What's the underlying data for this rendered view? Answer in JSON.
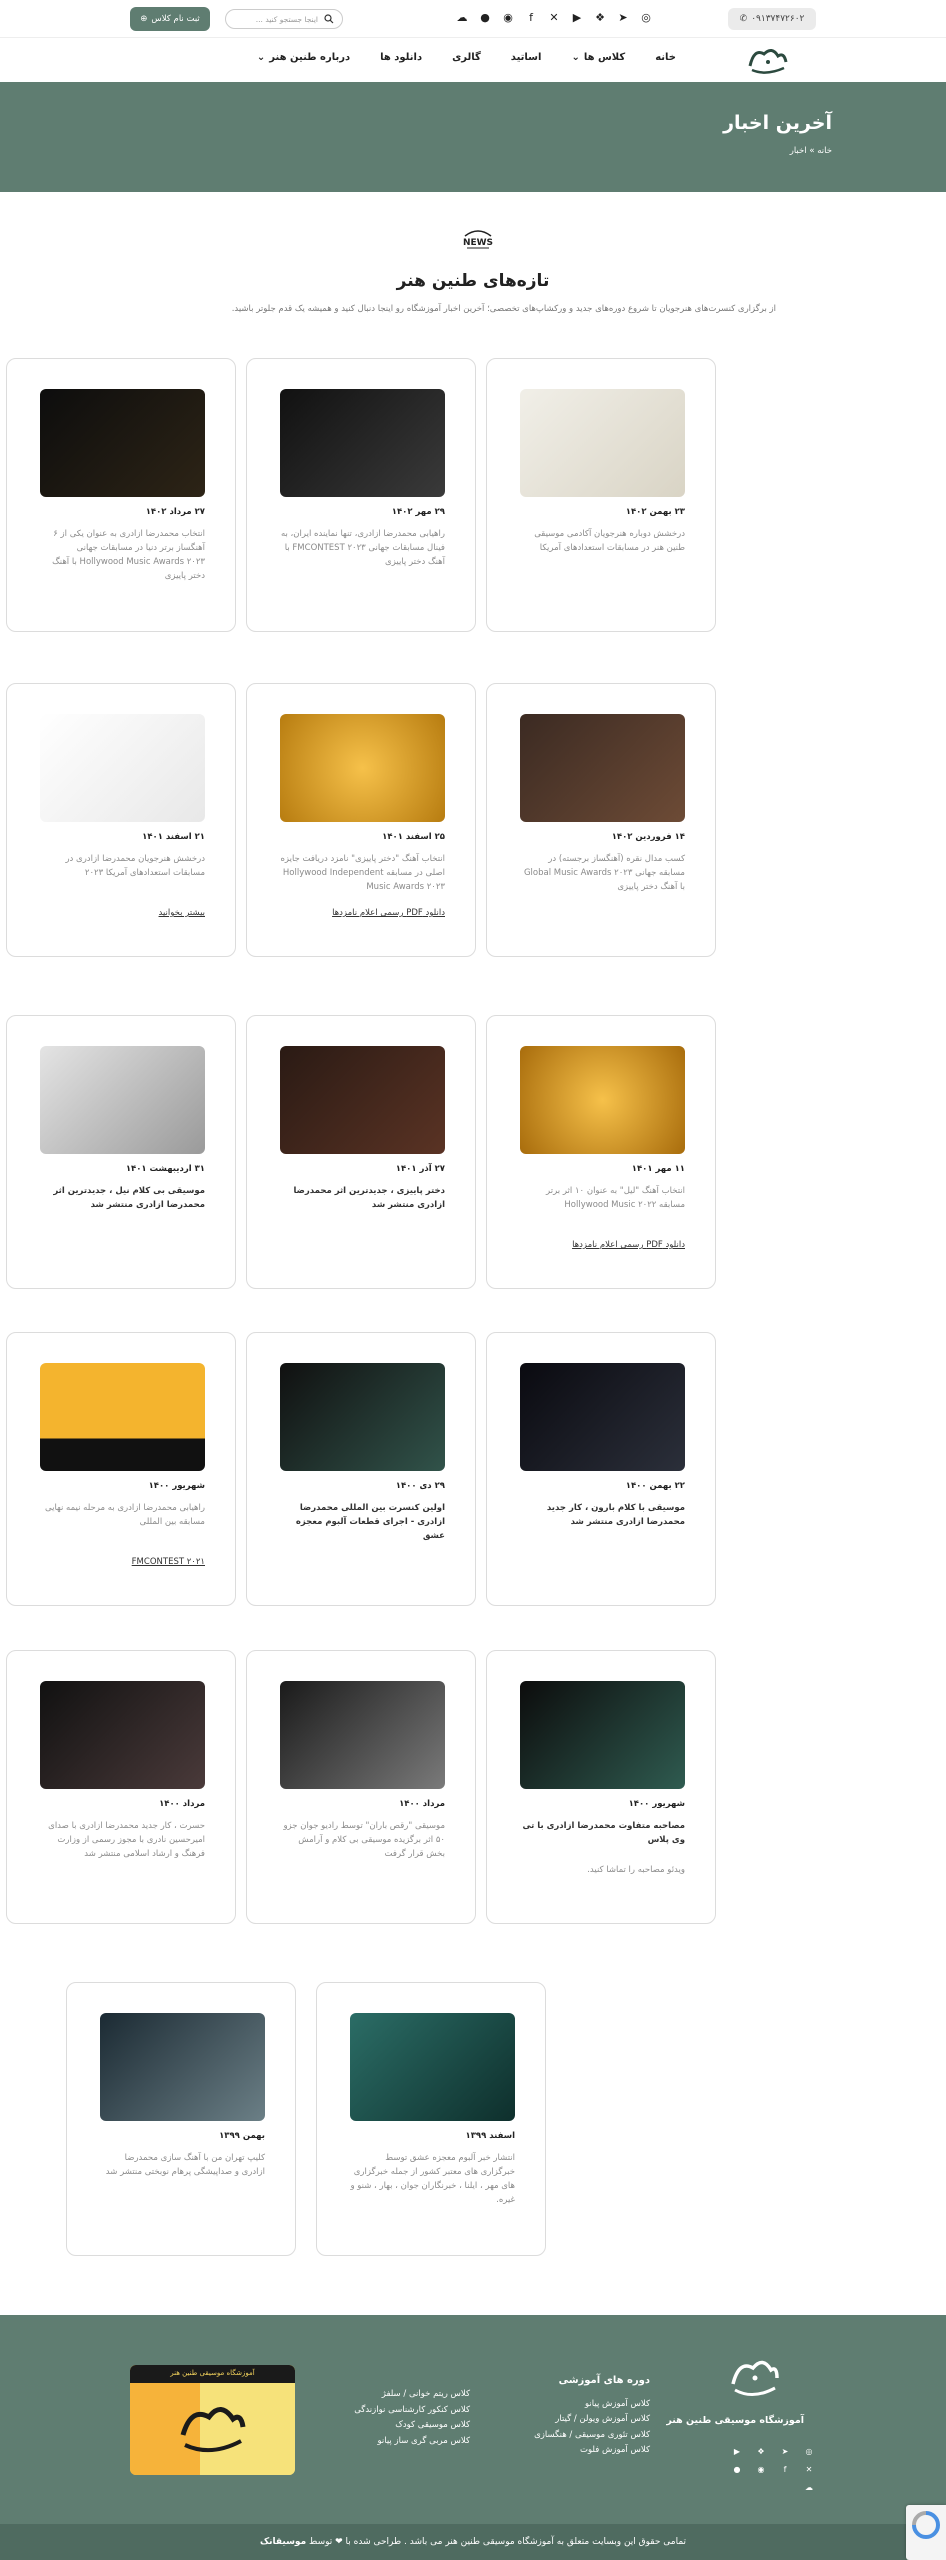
{
  "topbar": {
    "phone": "۰۹۱۳۷۴۷۲۶۰۲",
    "search_placeholder": "اینجا جستجو کنید ...",
    "register_label": "ثبت نام کلاس",
    "socials": [
      "instagram-icon",
      "telegram-icon",
      "aparat-icon",
      "youtube-icon",
      "x-icon",
      "facebook-icon",
      "spotify-icon",
      "apple-music-icon",
      "soundcloud-icon"
    ]
  },
  "nav": {
    "items": [
      {
        "label": "خانه"
      },
      {
        "label": "کلاس ها",
        "has_dropdown": true
      },
      {
        "label": "اساتید"
      },
      {
        "label": "گالری"
      },
      {
        "label": "دانلود ها"
      },
      {
        "label": "درباره طنین هنر",
        "has_dropdown": true
      }
    ]
  },
  "hero": {
    "title": "آخرین اخبار",
    "breadcrumb_home": "خانه",
    "breadcrumb_sep": "»",
    "breadcrumb_current": "اخبار"
  },
  "intro": {
    "badge": "NEWS",
    "title": "تازه‌های طنین هنر",
    "description": "از برگزاری کنسرت‌های هنرجویان تا شروع دوره‌های جدید و ورکشاپ‌های تخصصی؛ آخرین اخبار آموزشگاه رو اینجا دنبال کنید و همیشه یک قدم جلوتر باشید."
  },
  "cards": [
    {
      "date": "۲۳ بهمن ۱۴۰۲",
      "text": "درخشش دوباره هنرجویان آکادمی موسیقی طنین هنر در مسابقات استعدادهای آمریکا",
      "link": "",
      "image": "certificate"
    },
    {
      "date": "۲۹ مهر ۱۴۰۲",
      "text": "راهیابی محمدرضا ازادری، تنها نماینده ایران، به فینال مسابقات جهانی FMCONTEST ۲۰۲۳ با آهنگ دختر پاییزی",
      "link": "",
      "image": "fmcontest"
    },
    {
      "date": "۲۷ مرداد ۱۴۰۲",
      "text": "انتخاب محمدرضا ازادری به عنوان یکی از ۶ آهنگساز برتر دنیا در مسابقات جهانی Hollywood Music Awards ۲۰۲۳ با آهنگ دختر پاییزی",
      "link": "",
      "image": "hollywood"
    },
    {
      "date": "۱۴ فروردین ۱۴۰۲",
      "text": "کسب مدال نقره (آهنگساز برجسته) در مسابقه جهانی Global Music Awards ۲۰۲۳ با آهنگ دختر پاییزی",
      "link": "",
      "image": "silver-medal"
    },
    {
      "date": "۲۵ اسفند ۱۴۰۱",
      "text": "انتخاب آهنگ \"دختر پاییزی\" نامزد دریافت جایزه اصلی در مسابقه Hollywood Independent Music Awards ۲۰۲۳",
      "link": "دانلود PDF رسمی اعلام نامزدها",
      "image": "nomination"
    },
    {
      "date": "۲۱ اسفند ۱۴۰۱",
      "text": "درخشش هنرجویان محمدرضا ازادری در مسابقات استعدادهای آمریکا ۲۰۲۳",
      "link": "بیشتر بخوانید",
      "image": "students"
    },
    {
      "date": "۱۱ مهر ۱۴۰۱",
      "text": "انتخاب آهنگ \"لیل\" به عنوان ۱۰ اثر برتر مسابقه Hollywood Music ۲۰۲۲",
      "link": "دانلود PDF رسمی اعلام نامزدها",
      "image": "nomination2"
    },
    {
      "date": "۲۷ آذر ۱۴۰۱",
      "text": "دختر پاییزی ، جدیدترین اثر محمدرضا ازادری منتشر شد",
      "link": "",
      "dark": true,
      "image": "autumn"
    },
    {
      "date": "۳۱ اردیبهشت ۱۴۰۱",
      "text": "موسیقی بی کلام نیل ، جدیدترین اثر محمدرضا ازادری منتشر شد",
      "link": "",
      "dark": true,
      "image": "nil"
    },
    {
      "date": "۲۲ بهمن ۱۴۰۰",
      "text": "موسیقی با کلام بارون ، کار جدید محمدرضا ازادری منتشر شد",
      "link": "",
      "dark": true,
      "image": "baroon"
    },
    {
      "date": "۲۹ دی ۱۴۰۰",
      "text": "اولین کنسرت بین المللی محمدرضا ازادری - اجرای قطعات آلبوم معجزه عشق",
      "link": "",
      "dark": true,
      "image": "concert"
    },
    {
      "date": "شهریور ۱۴۰۰",
      "text": "راهیابی محمدرضا ازادری به مرحله نیمه نهایی مسابقه بین المللی",
      "link": "FMCONTEST ۲۰۲۱",
      "image": "fmc2021"
    },
    {
      "date": "شهریور ۱۴۰۰",
      "text": "مصاحبه متفاوت محمدرضا ازادری با تی وی پلاس",
      "text2": "ویدئو مصاحبه را تماشا کنید.",
      "link": "",
      "dark": true,
      "image": "tvplus"
    },
    {
      "date": "مرداد ۱۴۰۰",
      "text": "موسیقی \"رقص باران\" توسط رادیو جوان جزو ۵۰ اثر برگزیده موسیقی بی کلام و آرامش بخش قرار گرفت",
      "link": "",
      "image": "rain"
    },
    {
      "date": "مرداد ۱۴۰۰",
      "text": "حسرت ، کار جدید محمدرضا ازادری با صدای امیرحسین نادری با مجوز رسمی از وزارت فرهنگ و ارشاد اسلامی منتشر شد",
      "link": "",
      "image": "hasrat"
    },
    {
      "date": "اسفند ۱۳۹۹",
      "text": "انتشار خبر آلبوم معجزه عشق توسط خبرگزاری های معتبر کشور از جمله خبرگزاری های مهر ، ایلنا ، خبرنگاران جوان ، بهار ، شنو و غیره.",
      "link": "",
      "image": "miracle"
    },
    {
      "date": "بهمن ۱۳۹۹",
      "text": "کلیپ تهران من با آهنگ سازی محمدرضا ازادری و صداپیشگی پرهام نوبختی منتشر شد",
      "link": "",
      "image": "tehran"
    }
  ],
  "footer": {
    "school_name": "آموزشگاه موسیقی طنین هنر",
    "courses_title": "دوره های آموزشی",
    "courses": [
      "کلاس آموزش پیانو",
      "کلاس آموزش ویولن / گیتار",
      "کلاس تئوری موسیقی / هنگسازی",
      "کلاس آموزش فلوت"
    ],
    "courses2": [
      "کلاس ریتم خوانی / سلفژ",
      "کلاس کنکور کارشناسی نوازندگی",
      "کلاس موسیقی کودک",
      "کلاس مربی گری ساز پیانو"
    ],
    "promo_caption": "آموزشگاه موسیقی طنین هنر",
    "copyright": "تمامی حقوق این وبسایت متعلق به آموزشگاه موسیقی طنین هنر می باشد . طراحی شده با ❤ توسط",
    "copyright_brand": "موسیقانک"
  },
  "colors": {
    "brand": "#5f7d71",
    "brand_dark": "#4f6b60"
  }
}
